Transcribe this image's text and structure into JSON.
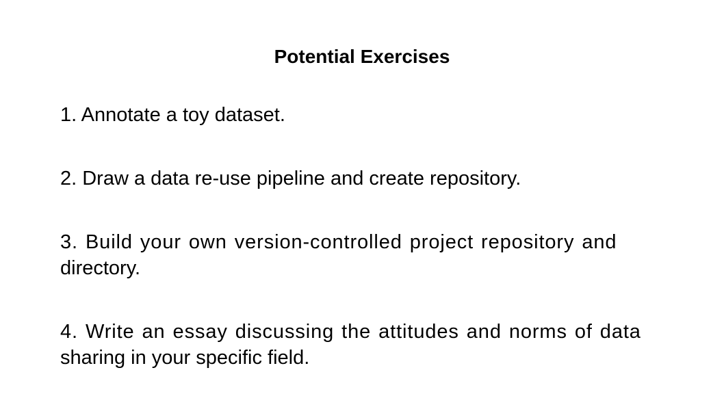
{
  "title": "Potential Exercises",
  "exercises": [
    {
      "lines": [
        "1. Annotate a toy dataset."
      ]
    },
    {
      "lines": [
        "2. Draw a data re-use pipeline and create repository."
      ]
    },
    {
      "lines": [
        "3. Build your own version-controlled project repository and",
        "directory."
      ]
    },
    {
      "lines": [
        "4. Write an essay discussing the attitudes and norms of data",
        "sharing in your specific field."
      ]
    }
  ]
}
